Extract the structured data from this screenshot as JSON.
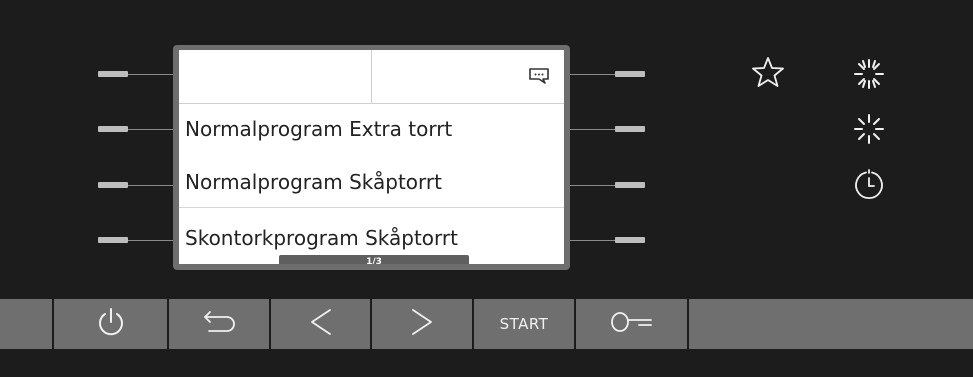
{
  "display": {
    "programs": [
      "Normalprogram Extra torrt",
      "Normalprogram Skåptorrt",
      "Skontorkprogram Skåptorrt"
    ],
    "page_indicator": "1/3",
    "header_icon": "message-icon"
  },
  "indicators": [
    "star-icon",
    "sun-icon",
    "half-sun-icon",
    "timer-icon"
  ],
  "controls": {
    "buttons": [
      {
        "name": "power-button",
        "icon": "power-icon"
      },
      {
        "name": "back-button",
        "icon": "back-arrow-icon"
      },
      {
        "name": "previous-button",
        "icon": "chevron-left-icon"
      },
      {
        "name": "next-button",
        "icon": "chevron-right-icon"
      },
      {
        "name": "start-button",
        "label": "START"
      },
      {
        "name": "key-lock-button",
        "icon": "key-icon"
      }
    ]
  },
  "colors": {
    "background": "#1c1c1c",
    "bar": "#6f6f6f",
    "screen": "#ffffff",
    "icon": "#f0f0f0"
  }
}
